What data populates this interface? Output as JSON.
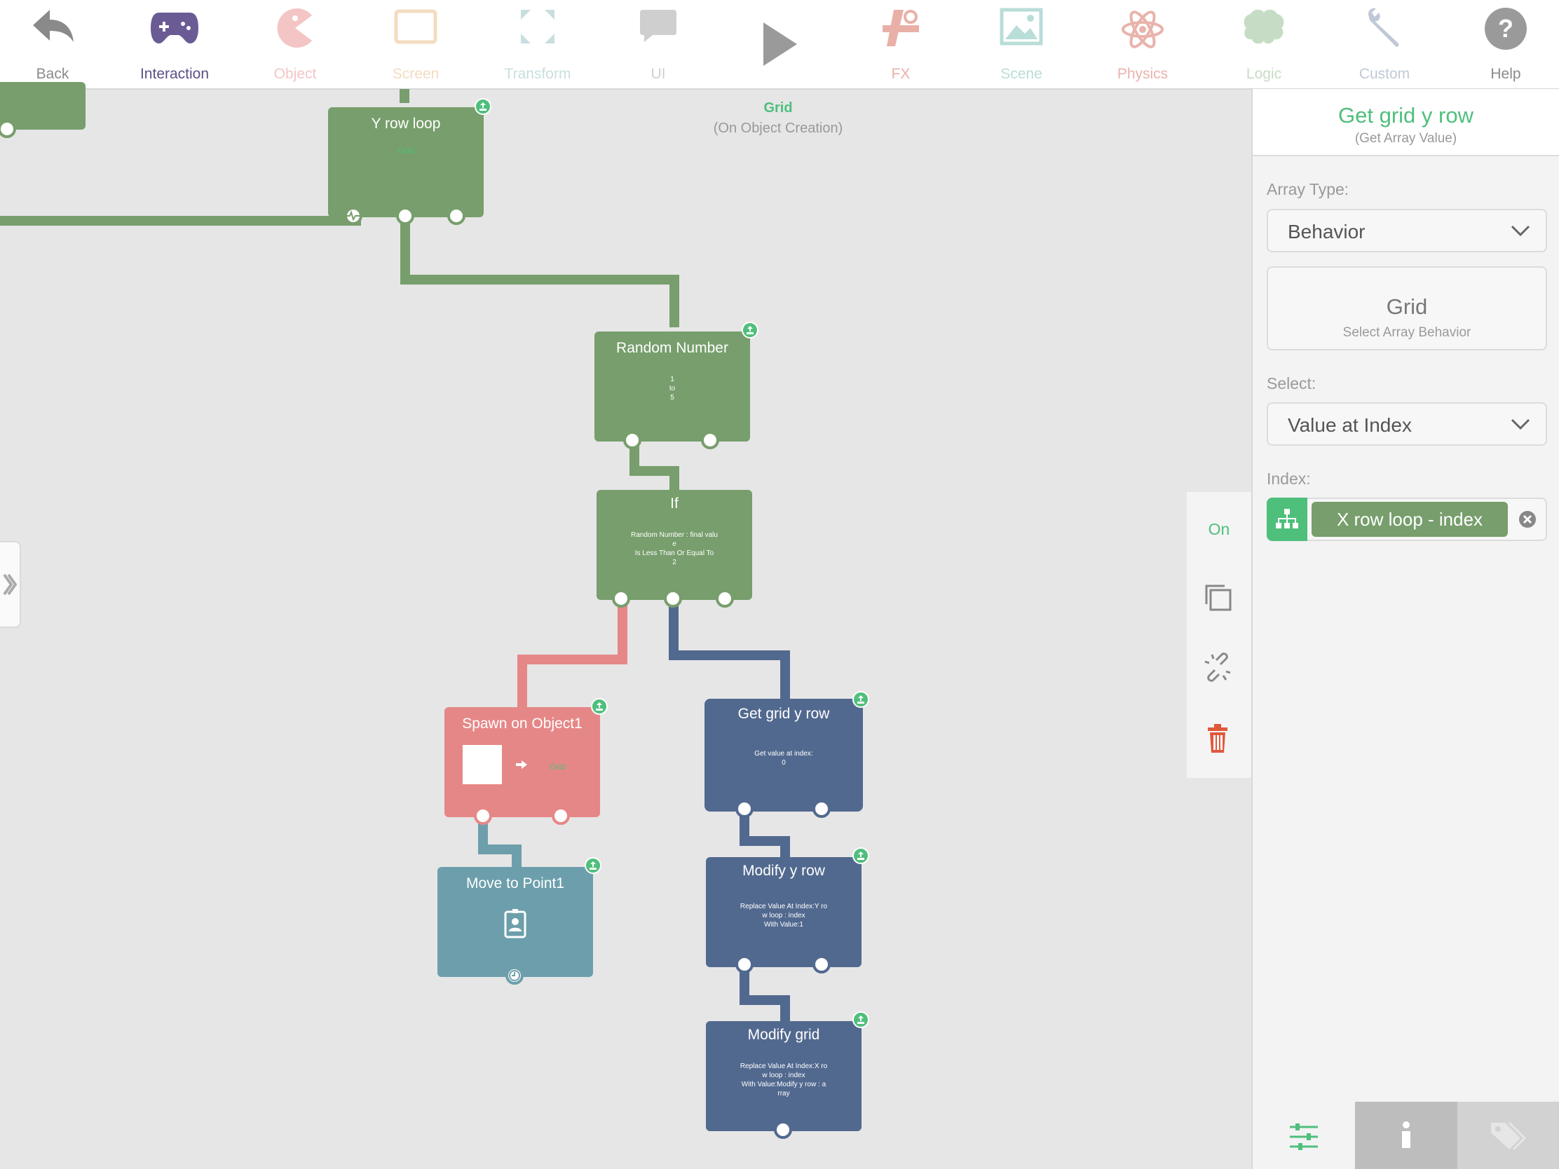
{
  "toolbar": {
    "items": [
      {
        "label": "Back",
        "icon": "back-arrow-icon",
        "color": "#8a8a8a"
      },
      {
        "label": "Interaction",
        "icon": "gamepad-icon",
        "color": "#6b5b95"
      },
      {
        "label": "Object",
        "icon": "pacman-icon",
        "color": "#f4c5c5"
      },
      {
        "label": "Screen",
        "icon": "screen-icon",
        "color": "#f3dcc0"
      },
      {
        "label": "Transform",
        "icon": "transform-icon",
        "color": "#c9dede"
      },
      {
        "label": "UI",
        "icon": "speech-bubble-icon",
        "color": "#cfcfcf"
      },
      {
        "label": "",
        "icon": "play-icon",
        "color": "#9a9a9a"
      },
      {
        "label": "FX",
        "icon": "fx-icon",
        "color": "#e9b0a8"
      },
      {
        "label": "Scene",
        "icon": "scene-image-icon",
        "color": "#b9ddd8"
      },
      {
        "label": "Physics",
        "icon": "atom-icon",
        "color": "#e9b3ac"
      },
      {
        "label": "Logic",
        "icon": "brain-icon",
        "color": "#c7dcc4"
      },
      {
        "label": "Custom",
        "icon": "wrench-icon",
        "color": "#bfc9d6"
      },
      {
        "label": "Help",
        "icon": "help-icon",
        "color": "#9a9a9a"
      }
    ]
  },
  "canvas": {
    "caption_title": "Grid",
    "caption_sub": "(On Object Creation)",
    "nodes": {
      "y_row_loop": {
        "title": "Y row loop",
        "sub": "Grid"
      },
      "random_number": {
        "title": "Random Number",
        "sub": [
          "1",
          "to",
          "5"
        ]
      },
      "if": {
        "title": "If",
        "sub": [
          "Random Number : final valu",
          "e",
          "Is Less Than Or Equal To",
          "2"
        ]
      },
      "spawn": {
        "title": "Spawn on Object1",
        "target": "Grid"
      },
      "move": {
        "title": "Move to Point1"
      },
      "get_grid_y_row": {
        "title": "Get grid y row",
        "sub": [
          "Get value at index:",
          "0"
        ]
      },
      "modify_y_row": {
        "title": "Modify y row",
        "sub": [
          "Replace Value At Index:Y ro",
          "w loop : index",
          "With Value:1"
        ]
      },
      "modify_grid": {
        "title": "Modify grid",
        "sub": [
          "Replace Value At Index:X ro",
          "w loop : index",
          "With Value:Modify y row : a",
          "rray"
        ]
      }
    }
  },
  "vertical_toolbar": {
    "on_label": "On"
  },
  "panel": {
    "title": "Get grid y row",
    "subtitle": "(Get Array Value)",
    "array_type_label": "Array Type:",
    "array_type_value": "Behavior",
    "behavior_name": "Grid",
    "behavior_hint": "Select Array Behavior",
    "select_label": "Select:",
    "select_value": "Value at Index",
    "index_label": "Index:",
    "index_value": "X row loop - index"
  },
  "colors": {
    "green_node": "#779e6c",
    "red_node": "#e68787",
    "teal_node": "#6c9fab",
    "blue_node": "#52698f",
    "accent": "#4fbf7c",
    "delete": "#e0583c"
  }
}
